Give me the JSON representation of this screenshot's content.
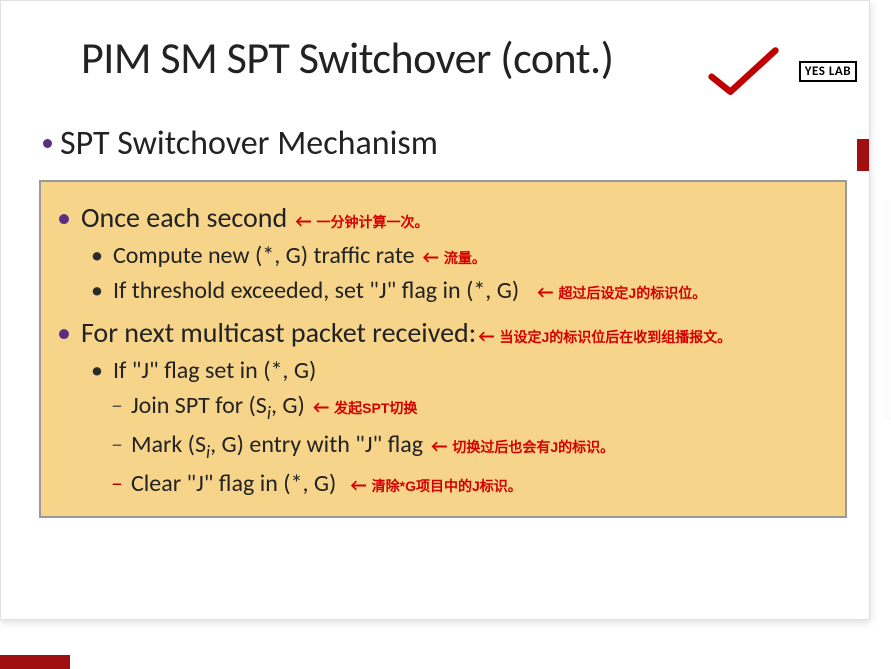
{
  "title": "PIM SM SPT Switchover (cont.)",
  "logo_text": "YES LAB",
  "heading": "SPT Switchover Mechanism",
  "colors": {
    "accent_red": "#d40000",
    "box_bg": "#f6d489",
    "purple": "#5a2d82",
    "deep_red": "#a01010"
  },
  "items": {
    "once": "Once each second",
    "once_anno": "一分钟计算一次。",
    "compute": "Compute new (*, G) traffic rate",
    "compute_anno": "流量。",
    "threshold": "If threshold exceeded, set \"J\" flag in (*, G)",
    "threshold_anno": "超过后设定J的标识位。",
    "fornext": "For next multicast packet received:",
    "fornext_anno": "当设定J的标识位后在收到组播报文。",
    "ifj": "If \"J\" flag set in (*, G)",
    "join_a": "Join SPT  for (S",
    "join_b": ", G)",
    "join_anno": "发起SPT切换",
    "mark_a": "Mark (S",
    "mark_b": ", G) entry with \"J\" flag",
    "mark_anno": "切换过后也会有J的标识。",
    "clear": "Clear \"J\" flag in (*, G)",
    "clear_anno": "清除*G项目中的J标识。",
    "sub_i": "i"
  }
}
